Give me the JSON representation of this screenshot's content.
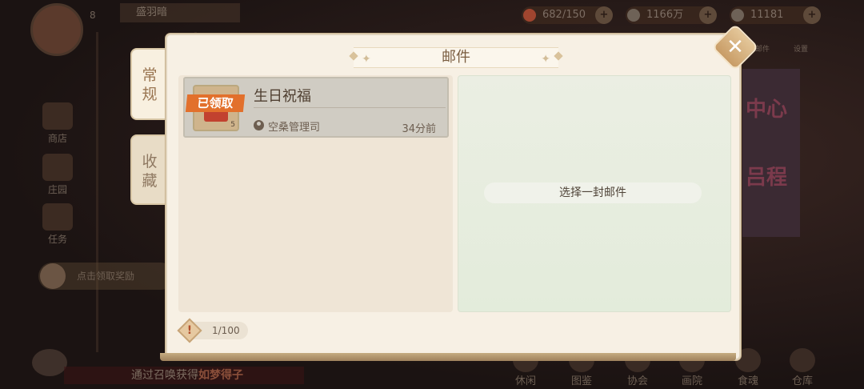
{
  "background": {
    "player_level": "8",
    "player_name": "盛羽暗",
    "resources": [
      {
        "value": "682/150",
        "icon": "stamina-icon",
        "color": "#c0503a"
      },
      {
        "value": "1166万",
        "icon": "feather-coin-icon",
        "color": "#d8d0c4"
      },
      {
        "value": "11181",
        "icon": "gem-icon",
        "color": "#d8d0c4"
      }
    ],
    "side_menu": [
      "商店",
      "庄园",
      "任务"
    ],
    "reward_prompt": "点击领取奖励",
    "bottom_nav": [
      "休闲",
      "图鉴",
      "协会",
      "画院",
      "食魂",
      "仓库"
    ],
    "ticker_text_prefix": "通过召唤获得",
    "ticker_text_highlight": "如梦得子",
    "banner_texts": [
      "中心",
      "吕程"
    ],
    "top_right_labels": [
      "邮件",
      "设置"
    ]
  },
  "mail_dialog": {
    "title": "邮件",
    "tabs": [
      {
        "label_chars": [
          "常",
          "规"
        ],
        "active": true
      },
      {
        "label_chars": [
          "收",
          "藏"
        ],
        "active": false
      }
    ],
    "mails": [
      {
        "title": "生日祝福",
        "sender": "空桑管理司",
        "time": "34分前",
        "status_tag": "已领取",
        "attachment_count": "5"
      }
    ],
    "detail_hint": "选择一封邮件",
    "mail_count": "1/100",
    "close_label": "✕"
  }
}
